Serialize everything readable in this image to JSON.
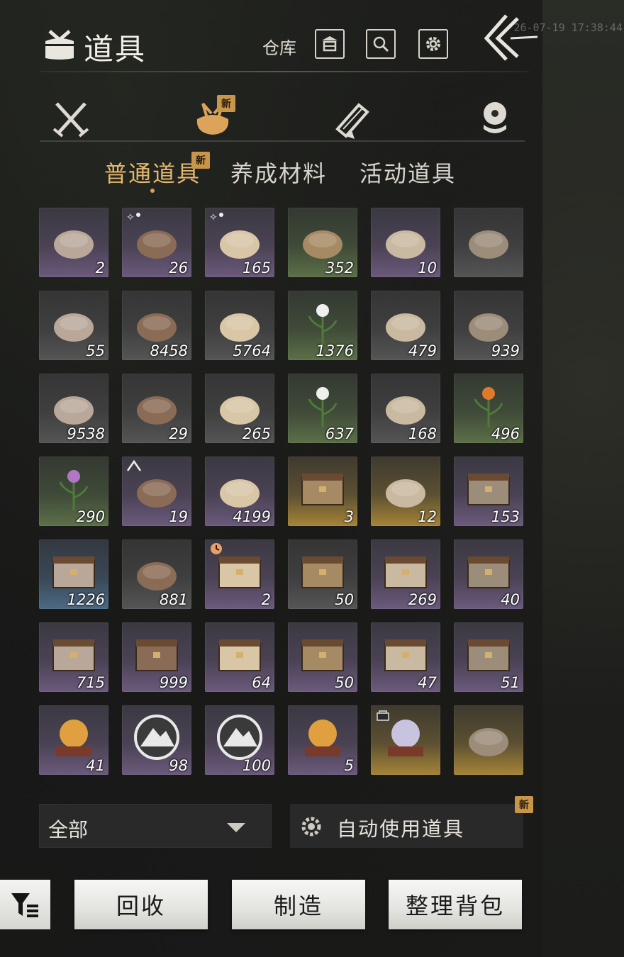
{
  "header": {
    "title": "道具",
    "warehouse_label": "仓库",
    "timestamp": "26-07-19 17:38:44"
  },
  "icons": {
    "title": "bag-icon",
    "warehouse": "warehouse-icon",
    "search": "search-icon",
    "settings": "gear-icon",
    "back": "back-arrow-icon"
  },
  "categories": [
    {
      "icon": "crossed-swords-icon",
      "active": false
    },
    {
      "icon": "bundle-bag-icon",
      "active": true,
      "badge": "新"
    },
    {
      "icon": "scroll-icon",
      "active": false
    },
    {
      "icon": "coin-stack-icon",
      "active": false
    }
  ],
  "subtabs": [
    {
      "label": "普通道具",
      "active": true,
      "badge": "新"
    },
    {
      "label": "养成材料",
      "active": false
    },
    {
      "label": "活动道具",
      "active": false
    }
  ],
  "items": [
    {
      "name": "cloth-pouch",
      "count": "2",
      "rarity": "purple"
    },
    {
      "name": "braised-meat-bowl",
      "count": "26",
      "rarity": "purple",
      "tag": "buff"
    },
    {
      "name": "cake-on-leaf",
      "count": "165",
      "rarity": "purple",
      "tag": "buff"
    },
    {
      "name": "wrapped-parcels",
      "count": "352",
      "rarity": "green"
    },
    {
      "name": "sword-banner",
      "count": "10",
      "rarity": "purple"
    },
    {
      "name": "seed-sack",
      "count": "",
      "rarity": "gray"
    },
    {
      "name": "raw-meat",
      "count": "55",
      "rarity": "gray"
    },
    {
      "name": "iron-ore",
      "count": "8458",
      "rarity": "gray"
    },
    {
      "name": "firewood",
      "count": "5764",
      "rarity": "gray"
    },
    {
      "name": "white-flower-herb",
      "count": "1376",
      "rarity": "green"
    },
    {
      "name": "pork-cuts",
      "count": "479",
      "rarity": "gray"
    },
    {
      "name": "oysters",
      "count": "939",
      "rarity": "gray"
    },
    {
      "name": "mushrooms",
      "count": "9538",
      "rarity": "gray"
    },
    {
      "name": "eggs",
      "count": "29",
      "rarity": "gray"
    },
    {
      "name": "berries-branch",
      "count": "265",
      "rarity": "gray"
    },
    {
      "name": "white-lotus-herb",
      "count": "637",
      "rarity": "green"
    },
    {
      "name": "blue-crystal-ore",
      "count": "168",
      "rarity": "gray"
    },
    {
      "name": "orange-lily",
      "count": "496",
      "rarity": "green"
    },
    {
      "name": "purple-flower-herb",
      "count": "290",
      "rarity": "green"
    },
    {
      "name": "stew-pot",
      "count": "19",
      "rarity": "purple",
      "tag": "up"
    },
    {
      "name": "gold-pattern-book",
      "count": "4199",
      "rarity": "purple"
    },
    {
      "name": "carved-chest-gold",
      "count": "3",
      "rarity": "gold"
    },
    {
      "name": "wind-wisp",
      "count": "12",
      "rarity": "gold"
    },
    {
      "name": "jade-gift-box",
      "count": "153",
      "rarity": "purple"
    },
    {
      "name": "fabric-drawer",
      "count": "1226",
      "rarity": "blue"
    },
    {
      "name": "wine-jars",
      "count": "881",
      "rarity": "gray"
    },
    {
      "name": "teal-gift-box",
      "count": "2",
      "rarity": "purple",
      "tag": "clock"
    },
    {
      "name": "open-tool-box",
      "count": "50",
      "rarity": "gray"
    },
    {
      "name": "wardrobe-cabinet",
      "count": "269",
      "rarity": "purple"
    },
    {
      "name": "wardrobe-cabinet-2",
      "count": "40",
      "rarity": "purple"
    },
    {
      "name": "red-chest",
      "count": "715",
      "rarity": "purple"
    },
    {
      "name": "red-chest-2",
      "count": "999",
      "rarity": "purple"
    },
    {
      "name": "dark-cabinet",
      "count": "64",
      "rarity": "purple"
    },
    {
      "name": "dark-cabinet-2",
      "count": "50",
      "rarity": "purple"
    },
    {
      "name": "gold-trim-chest",
      "count": "47",
      "rarity": "purple"
    },
    {
      "name": "silver-chest",
      "count": "51",
      "rarity": "purple"
    },
    {
      "name": "orb-on-stand",
      "count": "41",
      "rarity": "purple"
    },
    {
      "name": "pine-medallion",
      "count": "98",
      "rarity": "purple"
    },
    {
      "name": "mountain-medallion",
      "count": "100",
      "rarity": "purple"
    },
    {
      "name": "paw-orb-on-stand",
      "count": "5",
      "rarity": "purple"
    },
    {
      "name": "pearl-sphere",
      "count": "",
      "rarity": "gold",
      "tag": "lock"
    },
    {
      "name": "celadon-vase",
      "count": "",
      "rarity": "gold"
    }
  ],
  "controls": {
    "filter_select": "全部",
    "auto_use_label": "自动使用道具",
    "auto_use_badge": "新",
    "recycle_label": "回收",
    "craft_label": "制造",
    "sort_label": "整理背包"
  },
  "colors": {
    "accent_gold": "#e6b76e",
    "badge_gold": "#c8964a",
    "rarity_purple": "#6b5a7c",
    "rarity_green": "#5c7048",
    "rarity_blue": "#4c6a84",
    "rarity_gold": "#a68438"
  }
}
